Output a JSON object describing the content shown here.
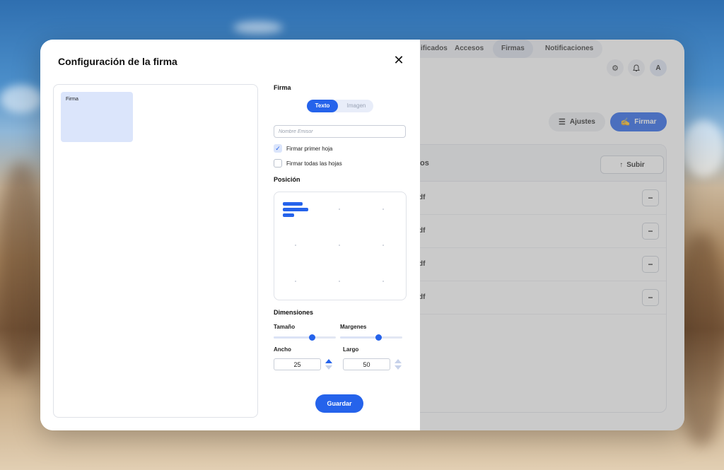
{
  "background_app": {
    "nav": {
      "items": [
        "ificados",
        "Accesos",
        "Firmas",
        "Notificaciones"
      ],
      "active": "Firmas"
    },
    "avatar_initial": "A",
    "toolbar": {
      "ajustes_label": "Ajustes",
      "firmar_label": "Firmar"
    },
    "files": {
      "title": "os",
      "upload_label": "Subir",
      "rows": [
        "df",
        "df",
        "df",
        "df"
      ],
      "remove_symbol": "−"
    }
  },
  "modal": {
    "title": "Configuración de la firma",
    "close_symbol": "✕",
    "preview": {
      "signature_label": "Firma"
    },
    "firma_section": {
      "label": "Firma",
      "toggle": {
        "text_option": "Texto",
        "image_option": "Imagen",
        "selected": "Texto"
      },
      "name_input": {
        "placeholder": "Nombre Emisor",
        "value": ""
      },
      "checkboxes": [
        {
          "label": "Firmar primer hoja",
          "checked": true
        },
        {
          "label": "Firmar todas las hojas",
          "checked": false
        }
      ]
    },
    "posicion_section": {
      "label": "Posición",
      "selected_cell": "top-left"
    },
    "dimensiones_section": {
      "label": "Dimensiones",
      "tamano": {
        "label": "Tamaño",
        "value_fraction": 0.62
      },
      "margenes": {
        "label": "Margenes",
        "value_fraction": 0.62
      },
      "ancho": {
        "label": "Ancho",
        "value": "25"
      },
      "largo": {
        "label": "Largo",
        "value": "50"
      }
    },
    "save_label": "Guardar"
  },
  "colors": {
    "accent": "#2563eb",
    "signature_block": "#dbe5fb"
  }
}
